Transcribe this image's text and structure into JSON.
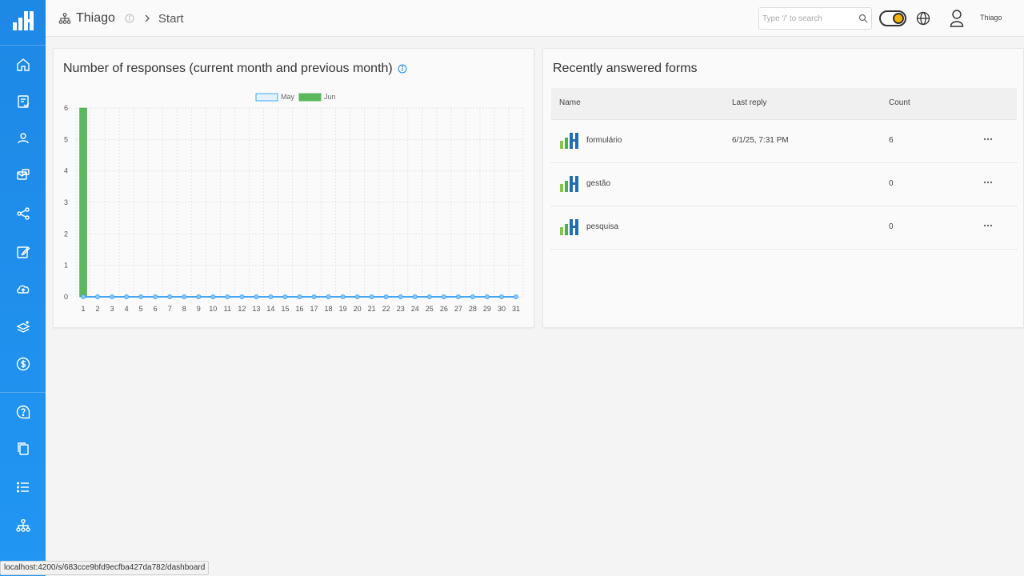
{
  "header": {
    "organization": "Thiago",
    "page": "Start",
    "search_placeholder": "Type '/' to search",
    "user_name": "Thiago"
  },
  "sidebar": {
    "items": [
      {
        "name": "home-icon"
      },
      {
        "name": "forms-icon"
      },
      {
        "name": "users-icon"
      },
      {
        "name": "mail-icon"
      },
      {
        "name": "share-icon"
      },
      {
        "name": "edit-icon"
      },
      {
        "name": "upload-icon"
      },
      {
        "name": "layers-icon"
      },
      {
        "name": "billing-icon"
      },
      {
        "name": "help-icon"
      },
      {
        "name": "copy-icon"
      },
      {
        "name": "list-icon"
      },
      {
        "name": "organization-icon"
      }
    ]
  },
  "chart_card": {
    "title": "Number of responses (current month and previous month)"
  },
  "chart_data": {
    "type": "bar",
    "categories": [
      "1",
      "2",
      "3",
      "4",
      "5",
      "6",
      "7",
      "8",
      "9",
      "10",
      "11",
      "12",
      "13",
      "14",
      "15",
      "16",
      "17",
      "18",
      "19",
      "20",
      "21",
      "22",
      "23",
      "24",
      "25",
      "26",
      "27",
      "28",
      "29",
      "30",
      "31"
    ],
    "series": [
      {
        "name": "May",
        "color": "#90caf9",
        "values": [
          0,
          0,
          0,
          0,
          0,
          0,
          0,
          0,
          0,
          0,
          0,
          0,
          0,
          0,
          0,
          0,
          0,
          0,
          0,
          0,
          0,
          0,
          0,
          0,
          0,
          0,
          0,
          0,
          0,
          0,
          0
        ]
      },
      {
        "name": "Jun",
        "color": "#5cb85c",
        "values": [
          6,
          0,
          0,
          0,
          0,
          0,
          0,
          0,
          0,
          0,
          0,
          0,
          0,
          0,
          0,
          0,
          0,
          0,
          0,
          0,
          0,
          0,
          0,
          0,
          0,
          0,
          0,
          0,
          0,
          0,
          0
        ]
      }
    ],
    "ylim": [
      0,
      6
    ],
    "yticks": [
      0,
      1,
      2,
      3,
      4,
      5,
      6
    ],
    "grid": true,
    "legend": "top-center"
  },
  "forms_card": {
    "title": "Recently answered forms",
    "columns": [
      "Name",
      "Last reply",
      "Count"
    ],
    "rows": [
      {
        "name": "formulário",
        "last_reply": "6/1/25, 7:31 PM",
        "count": "6"
      },
      {
        "name": "gestão",
        "last_reply": "",
        "count": "0"
      },
      {
        "name": "pesquisa",
        "last_reply": "",
        "count": "0"
      }
    ]
  },
  "status_bar": {
    "url": "localhost:4200/s/683cce9bfd9ecfba427da782/dashboard"
  },
  "colors": {
    "sidebar": "#1e88e5",
    "bar_jun": "#5cb85c",
    "line_may": "#42a5f5"
  }
}
